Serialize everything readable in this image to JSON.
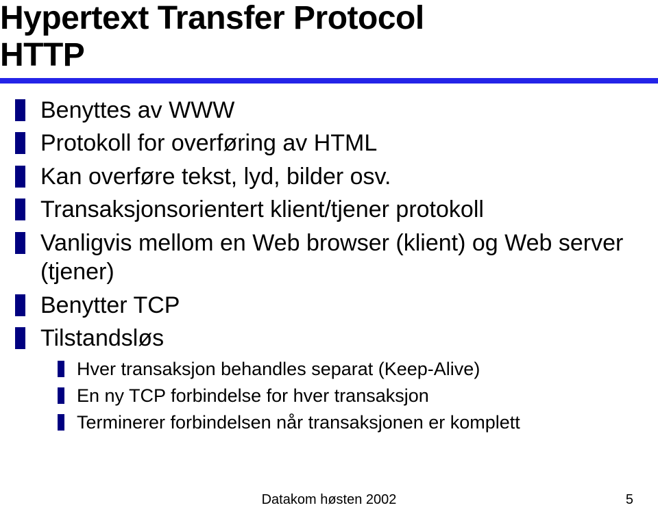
{
  "title": {
    "line1": "Hypertext Transfer Protocol",
    "line2": "HTTP"
  },
  "bullets": [
    {
      "text": "Benyttes av WWW"
    },
    {
      "text": "Protokoll for overføring av HTML"
    },
    {
      "text": "Kan overføre tekst, lyd, bilder osv."
    },
    {
      "text": "Transaksjonsorientert klient/tjener protokoll"
    },
    {
      "text": "Vanligvis mellom en Web browser (klient) og Web server (tjener)"
    },
    {
      "text": "Benytter TCP"
    },
    {
      "text": "Tilstandsløs",
      "sub": [
        {
          "text": "Hver transaksjon behandles separat (Keep-Alive)"
        },
        {
          "text": "En ny TCP forbindelse for hver transaksjon"
        },
        {
          "text": "Terminerer forbindelsen når transaksjonen er komplett"
        }
      ]
    }
  ],
  "footer": {
    "center": "Datakom høsten 2002",
    "page": "5"
  }
}
